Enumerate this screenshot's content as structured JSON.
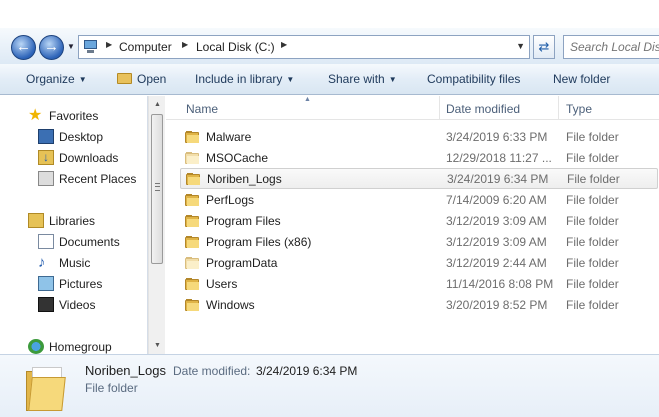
{
  "address": {
    "crumbs": [
      "Computer",
      "Local Disk (C:)"
    ]
  },
  "search": {
    "placeholder": "Search Local Disk"
  },
  "toolbar": {
    "organize": "Organize",
    "open": "Open",
    "include_in_library": "Include in library",
    "share_with": "Share with",
    "compatibility_files": "Compatibility files",
    "new_folder": "New folder"
  },
  "navpane": {
    "favorites": "Favorites",
    "desktop": "Desktop",
    "downloads": "Downloads",
    "recent_places": "Recent Places",
    "libraries": "Libraries",
    "documents": "Documents",
    "music": "Music",
    "pictures": "Pictures",
    "videos": "Videos",
    "homegroup": "Homegroup"
  },
  "columns": {
    "name": "Name",
    "date_modified": "Date modified",
    "type": "Type"
  },
  "rows": [
    {
      "name": "Malware",
      "date": "3/24/2019 6:33 PM",
      "type": "File folder"
    },
    {
      "name": "MSOCache",
      "date": "12/29/2018 11:27 ...",
      "type": "File folder"
    },
    {
      "name": "Noriben_Logs",
      "date": "3/24/2019 6:34 PM",
      "type": "File folder"
    },
    {
      "name": "PerfLogs",
      "date": "7/14/2009 6:20 AM",
      "type": "File folder"
    },
    {
      "name": "Program Files",
      "date": "3/12/2019 3:09 AM",
      "type": "File folder"
    },
    {
      "name": "Program Files (x86)",
      "date": "3/12/2019 3:09 AM",
      "type": "File folder"
    },
    {
      "name": "ProgramData",
      "date": "3/12/2019 2:44 AM",
      "type": "File folder"
    },
    {
      "name": "Users",
      "date": "11/14/2016 8:08 PM",
      "type": "File folder"
    },
    {
      "name": "Windows",
      "date": "3/20/2019 8:52 PM",
      "type": "File folder"
    }
  ],
  "details": {
    "name": "Noriben_Logs",
    "date_label": "Date modified:",
    "date": "3/24/2019 6:34 PM",
    "type": "File folder"
  }
}
